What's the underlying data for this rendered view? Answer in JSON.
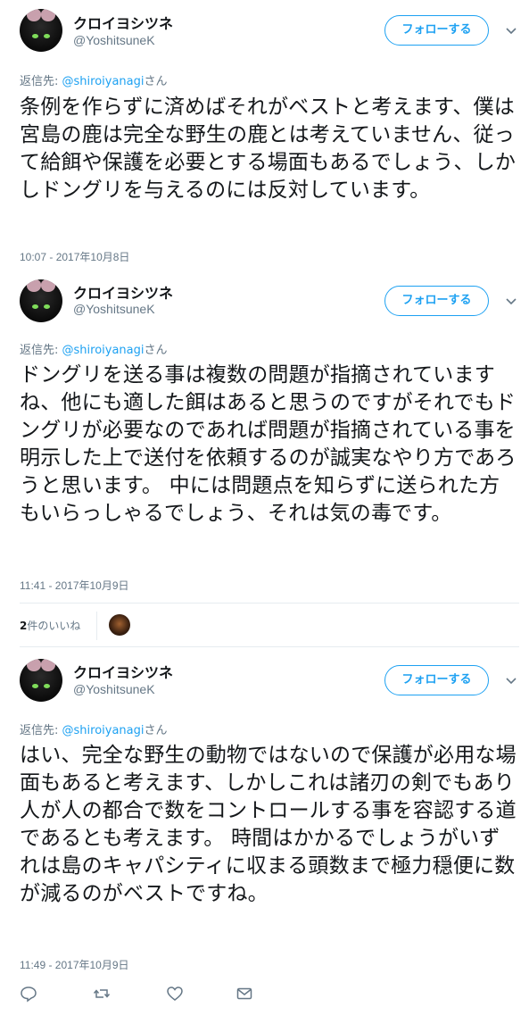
{
  "tweets": [
    {
      "name": "クロイヨシツネ",
      "handle": "@YoshitsuneK",
      "follow_label": "フォローする",
      "reply_prefix": "返信先: ",
      "reply_mention": "@shiroiyanagi",
      "reply_suffix": "さん",
      "body": "条例を作らずに済めばそれがベストと考えます、僕は宮島の鹿は完全な野生の鹿とは考えていません、従って給餌や保護を必要とする場面もあるでしょう、しかしドングリを与えるのには反対しています。",
      "timestamp": "10:07 - 2017年10月8日"
    },
    {
      "name": "クロイヨシツネ",
      "handle": "@YoshitsuneK",
      "follow_label": "フォローする",
      "reply_prefix": "返信先: ",
      "reply_mention": "@shiroiyanagi",
      "reply_suffix": "さん",
      "body": "ドングリを送る事は複数の問題が指摘されていますね、他にも適した餌はあると思うのですがそれでもドングリが必要なのであれば問題が指摘されている事を明示した上で送付を依頼するのが誠実なやり方であろうと思います。 中には問題点を知らずに送られた方もいらっしゃるでしょう、それは気の毒です。",
      "timestamp": "11:41 - 2017年10月9日"
    },
    {
      "name": "クロイヨシツネ",
      "handle": "@YoshitsuneK",
      "follow_label": "フォローする",
      "reply_prefix": "返信先: ",
      "reply_mention": "@shiroiyanagi",
      "reply_suffix": "さん",
      "body": "はい、完全な野生の動物ではないので保護が必用な場面もあると考えます、しかしこれは諸刃の剣でもあり人が人の都合で数をコントロールする事を容認する道であるとも考えます。 時間はかかるでしょうがいずれは島のキャパシティに収まる頭数まで極力穏便に数が減るのがベストですね。",
      "timestamp": "11:49 - 2017年10月9日"
    }
  ],
  "likes": {
    "count": "2",
    "label": "件のいいね"
  },
  "actions": {
    "icons": [
      "reply-icon",
      "retweet-icon",
      "like-icon",
      "message-icon"
    ]
  },
  "colors": {
    "accent": "#1da1f2",
    "text": "#14171a",
    "secondary": "#657786",
    "divider": "#e6ecf0"
  }
}
